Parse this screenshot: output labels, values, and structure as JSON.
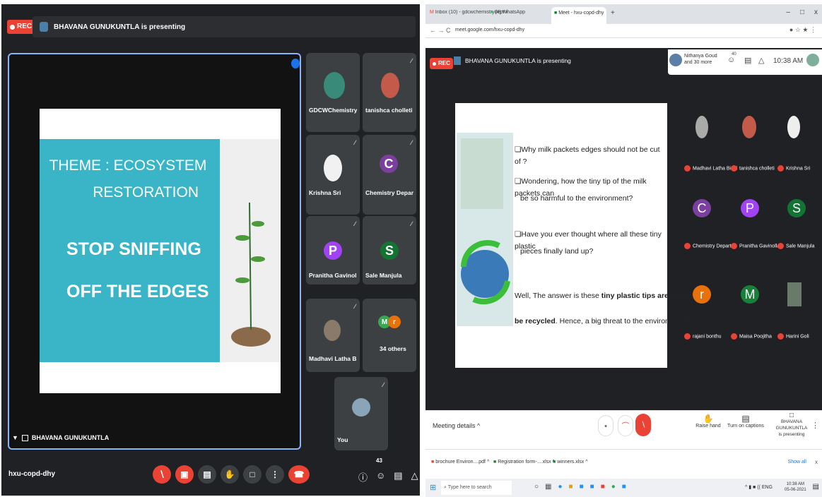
{
  "left": {
    "rec_label": "REC",
    "presenting": "BHAVANA GUNUKUNTLA is presenting",
    "slide": {
      "theme_line1": "THEME : ECOSYSTEM",
      "theme_line2": "RESTORATION",
      "headline_line1": "STOP SNIFFING",
      "headline_line2": "OFF THE EDGES"
    },
    "presenter_label": "BHAVANA GUNUKUNTLA",
    "tiles": [
      {
        "name": "GDCWChemistry Dept"
      },
      {
        "name": "tanishca cholleti"
      },
      {
        "name": "Krishna Sri"
      },
      {
        "name": "Chemistry Departme...",
        "initial": "C",
        "color": "#7b3fa0"
      },
      {
        "name": "Pranitha Gavinolla",
        "initial": "P",
        "color": "#a142f4"
      },
      {
        "name": "Sale Manjula",
        "initial": "S",
        "color": "#137333"
      },
      {
        "name": "Madhavi Latha Bingi"
      },
      {
        "name": "34 others",
        "initials": [
          "M",
          "r"
        ]
      },
      {
        "name": "You"
      }
    ],
    "meeting_code": "hxu-copd-dhy",
    "participants_count": "43"
  },
  "right": {
    "tabs": [
      "Inbox (10) - gdcwchemistrydept",
      "(4) WhatsApp",
      "Meet - hxu-copd-dhy"
    ],
    "url": "meet.google.com/hxu-copd-dhy",
    "rec_label": "REC",
    "presenting": "BHAVANA GUNUKUNTLA is presenting",
    "viewer_line1": "Nithanya Goud",
    "viewer_line2": "and 30 more",
    "count": "40",
    "time": "10:38 AM",
    "slide": {
      "b1": "❏Why milk packets edges should not be cut of ?",
      "b2a": "❏Wondering, how the tiny tip of the milk packets can",
      "b2b": "be so harmful to the environment?",
      "b3a": "❏Have you ever thought where all these tiny plastic",
      "b3b": "pieces finally land up?",
      "p1a": "Well, The answer is these ",
      "p1b": "tiny plastic tips are difficult to",
      "p2a": "be recycled",
      "p2b": ". Hence, a big threat to the environment."
    },
    "tiles": [
      {
        "name": "Madhavi Latha Bingi"
      },
      {
        "name": "tanishca cholleti"
      },
      {
        "name": "Krishna Sri"
      },
      {
        "name": "Chemistry Depart...",
        "initial": "C",
        "color": "#7b3fa0"
      },
      {
        "name": "Pranitha Gavinolla",
        "initial": "P",
        "color": "#a142f4"
      },
      {
        "name": "Sale Manjula",
        "initial": "S",
        "color": "#137333"
      },
      {
        "name": "rajani bonthu",
        "initial": "r",
        "color": "#e8710a"
      },
      {
        "name": "Maisa Poojitha",
        "initial": "M",
        "color": "#188038"
      },
      {
        "name": "Harini Goli"
      }
    ],
    "meeting_details": "Meeting details  ^",
    "raise_hand": "Raise hand",
    "captions": "Turn on captions",
    "presenting_name": "BHAVANA GUNUKUNTLA",
    "presenting_sub": "is presenting",
    "downloads": [
      "brochure Environ....pdf",
      "Registration form-....xlsx",
      "winners.xlsx"
    ],
    "show_all": "Show all",
    "search": "Type here to search",
    "tray_lang": "ENG",
    "tray_time": "10:38 AM",
    "tray_date": "05-06-2021"
  }
}
